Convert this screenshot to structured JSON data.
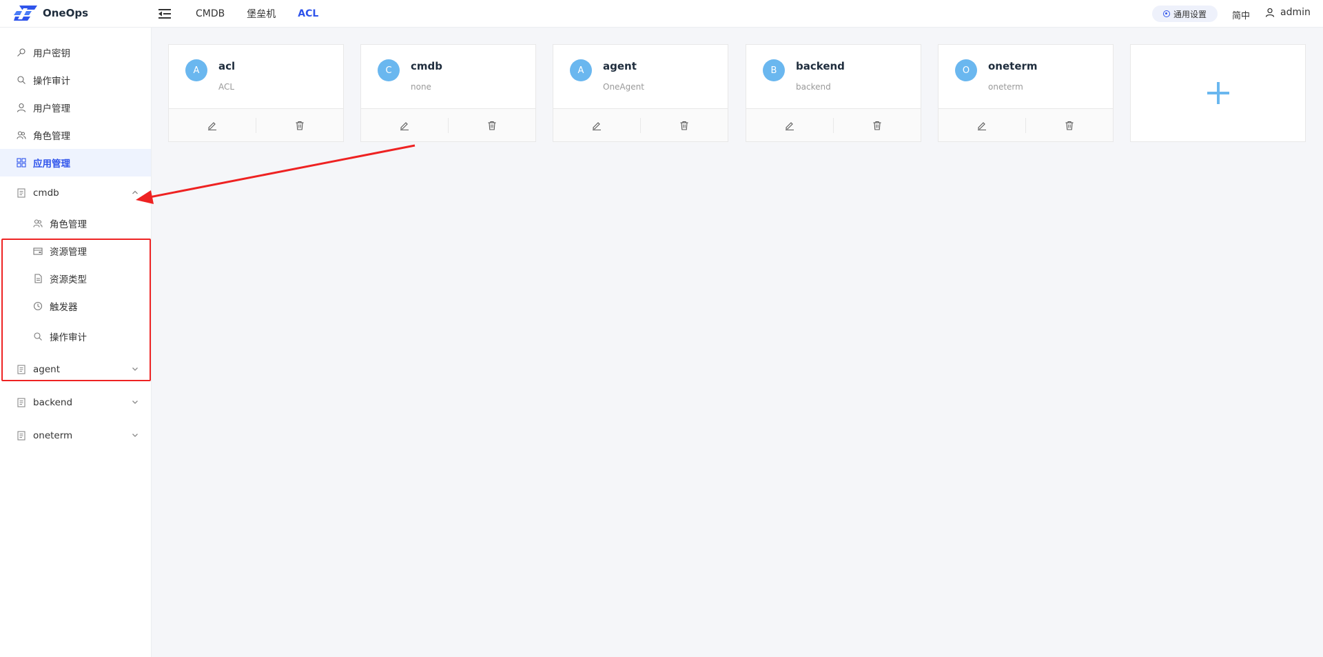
{
  "app": {
    "name": "OneOps"
  },
  "header": {
    "nav": [
      "CMDB",
      "堡垒机",
      "ACL"
    ],
    "active_nav": "ACL",
    "settings_label": "通用设置",
    "lang_label": "简中",
    "user_name": "admin"
  },
  "sidebar": {
    "items": [
      {
        "label": "用户密钥",
        "icon": "key-icon"
      },
      {
        "label": "操作审计",
        "icon": "search-icon"
      },
      {
        "label": "用户管理",
        "icon": "user-icon"
      },
      {
        "label": "角色管理",
        "icon": "users-icon"
      },
      {
        "label": "应用管理",
        "icon": "apps-icon",
        "active": true
      }
    ],
    "groups": [
      {
        "label": "cmdb",
        "expanded": true,
        "children": [
          {
            "label": "角色管理",
            "icon": "users-icon"
          },
          {
            "label": "资源管理",
            "icon": "wallet-icon"
          },
          {
            "label": "资源类型",
            "icon": "file-icon"
          },
          {
            "label": "触发器",
            "icon": "clock-icon"
          },
          {
            "label": "操作审计",
            "icon": "search-icon"
          }
        ]
      },
      {
        "label": "agent",
        "expanded": false
      },
      {
        "label": "backend",
        "expanded": false
      },
      {
        "label": "oneterm",
        "expanded": false
      }
    ]
  },
  "apps": [
    {
      "avatar": "A",
      "name": "acl",
      "description": "ACL"
    },
    {
      "avatar": "C",
      "name": "cmdb",
      "description": "none"
    },
    {
      "avatar": "A",
      "name": "agent",
      "description": "OneAgent"
    },
    {
      "avatar": "B",
      "name": "backend",
      "description": "backend"
    },
    {
      "avatar": "O",
      "name": "oneterm",
      "description": "oneterm"
    }
  ],
  "colors": {
    "accent": "#2f54eb",
    "avatar": "#6ab7ef",
    "annotation": "#ee2222"
  }
}
